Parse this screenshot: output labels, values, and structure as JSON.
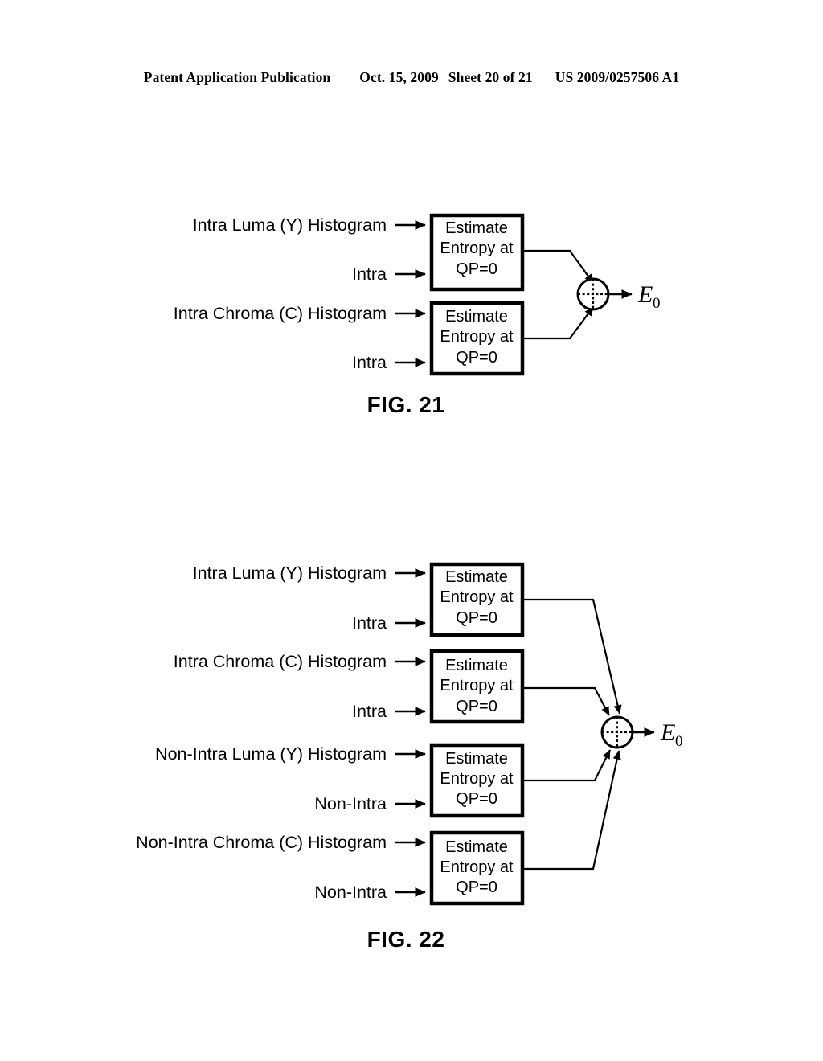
{
  "header": {
    "publication": "Patent Application Publication",
    "date": "Oct. 15, 2009",
    "sheet": "Sheet 20 of 21",
    "docnumber": "US 2009/0257506 A1"
  },
  "block_text": {
    "line1": "Estimate",
    "line2": "Entropy at",
    "line3": "QP=0"
  },
  "figures": [
    {
      "id": "fig21",
      "caption": "FIG.  21",
      "output_label": "E",
      "output_subscript": "0",
      "blocks": [
        {
          "id": "fig21-block-1",
          "signal_label": "Intra Luma (Y) Histogram",
          "mode_label": "Intra",
          "text": [
            "Estimate",
            "Entropy at",
            "QP=0"
          ]
        },
        {
          "id": "fig21-block-2",
          "signal_label": "Intra Chroma (C) Histogram",
          "mode_label": "Intra",
          "text": [
            "Estimate",
            "Entropy at",
            "QP=0"
          ]
        }
      ]
    },
    {
      "id": "fig22",
      "caption": "FIG.  22",
      "output_label": "E",
      "output_subscript": "0",
      "blocks": [
        {
          "id": "fig22-block-1",
          "signal_label": "Intra Luma (Y) Histogram",
          "mode_label": "Intra",
          "text": [
            "Estimate",
            "Entropy at",
            "QP=0"
          ]
        },
        {
          "id": "fig22-block-2",
          "signal_label": "Intra Chroma (C) Histogram",
          "mode_label": "Intra",
          "text": [
            "Estimate",
            "Entropy at",
            "QP=0"
          ]
        },
        {
          "id": "fig22-block-3",
          "signal_label": "Non-Intra Luma (Y) Histogram",
          "mode_label": "Non-Intra",
          "text": [
            "Estimate",
            "Entropy at",
            "QP=0"
          ]
        },
        {
          "id": "fig22-block-4",
          "signal_label": "Non-Intra Chroma (C) Histogram",
          "mode_label": "Non-Intra",
          "text": [
            "Estimate",
            "Entropy at",
            "QP=0"
          ]
        }
      ]
    }
  ],
  "colors": {
    "ink": "#000000",
    "paper": "#ffffff"
  }
}
